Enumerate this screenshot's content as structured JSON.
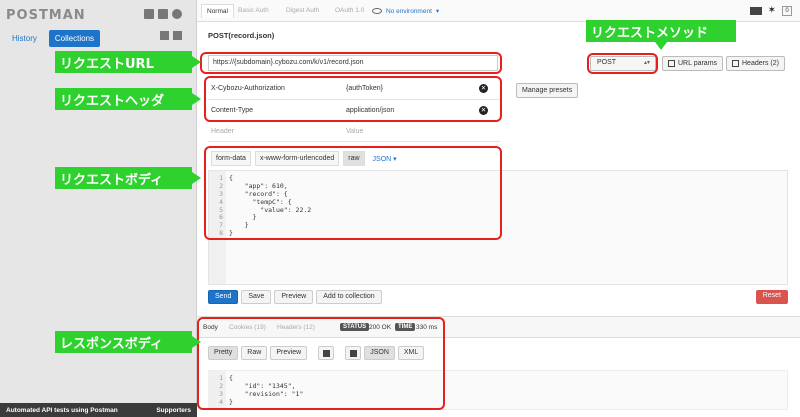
{
  "sidebar": {
    "logo": "POSTMAN",
    "tabs": [
      "History",
      "Collections"
    ],
    "footer_left": "Automated API tests using Postman",
    "footer_right": "Supporters"
  },
  "topbar": {
    "auth_tabs": [
      "Normal",
      "Basic Auth",
      "Digest Auth",
      "OAuth 1.0"
    ],
    "environment": "No environment"
  },
  "request": {
    "title": "POST(record.json)",
    "url": "https://{subdomain}.cybozu.com/k/v1/record.json",
    "method": "POST",
    "url_params_label": "URL params",
    "headers_label": "Headers (2)",
    "headers": [
      {
        "key": "X-Cybozu-Authorization",
        "value": "{authToken}"
      },
      {
        "key": "Content-Type",
        "value": "application/json"
      }
    ],
    "header_placeholder": {
      "key": "Header",
      "value": "Value"
    },
    "manage_presets": "Manage presets",
    "body_tabs": [
      "form-data",
      "x-www-form-urlencoded",
      "raw",
      "JSON"
    ],
    "body_lines": [
      "{",
      "    \"app\": 610,",
      "    \"record\": {",
      "      \"tempC\": {",
      "        \"value\": 22.2",
      "      }",
      "    }",
      "}"
    ],
    "actions": [
      "Send",
      "Save",
      "Preview",
      "Add to collection"
    ],
    "reset": "Reset"
  },
  "response": {
    "tabs": [
      "Body",
      "Cookies (19)",
      "Headers (12)"
    ],
    "status_label": "STATUS",
    "status_value": "200 OK",
    "time_label": "TIME",
    "time_value": "330 ms",
    "format_buttons": [
      "Pretty",
      "Raw",
      "Preview"
    ],
    "type_buttons": [
      "JSON",
      "XML"
    ],
    "body_lines": [
      "{",
      "    \"id\": \"1345\",",
      "    \"revision\": \"1\"",
      "}"
    ]
  },
  "annotations": {
    "url": "リクエストURL",
    "header": "リクエストヘッダ",
    "body": "リクエストボディ",
    "method": "リクエストメソッド",
    "response": "レスポンスボディ"
  },
  "colors": {
    "accent": "#1d74c8",
    "callout": "#2fd12f",
    "highlight": "#e8201d",
    "reset": "#d9534f"
  }
}
